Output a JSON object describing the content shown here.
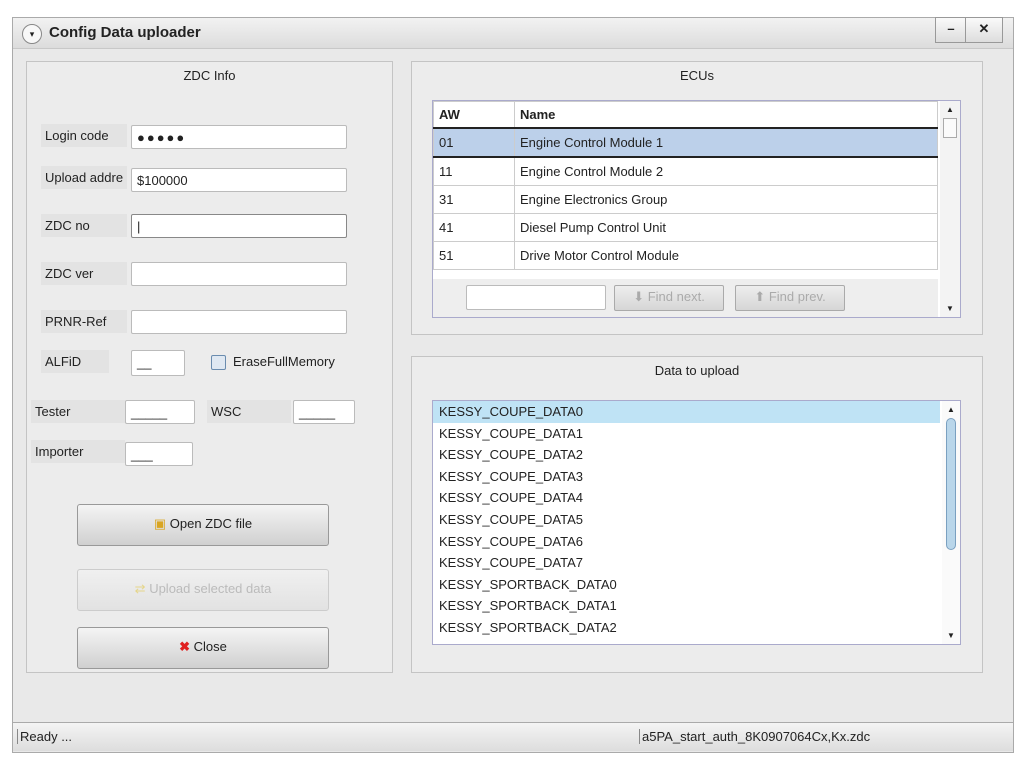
{
  "window": {
    "title": "Config Data uploader",
    "minimize": "–",
    "close": "✕",
    "menu_glyph": "▾"
  },
  "zdc": {
    "title": "ZDC Info",
    "login_label": "Login code",
    "login_value": "●●●●●",
    "upload_label": "Upload addre",
    "upload_value": "$100000",
    "zdcno_label": "ZDC no",
    "zdcver_label": "ZDC ver",
    "prnr_label": "PRNR-Ref",
    "alfid_label": "ALFiD",
    "alfid_value": "__",
    "erase_label": "EraseFullMemory",
    "tester_label": "Tester",
    "tester_value": "_____",
    "wsc_label": "WSC",
    "wsc_value": "_____",
    "importer_label": "Importer",
    "importer_value": "___",
    "open_label": "Open ZDC file",
    "upload_btn_label": "Upload selected data",
    "close_label": "Close"
  },
  "ecus": {
    "title": "ECUs",
    "headers": [
      "AW",
      "Name"
    ],
    "rows": [
      [
        "01",
        "Engine Control Module 1"
      ],
      [
        "11",
        "Engine Control Module 2"
      ],
      [
        "31",
        "Engine Electronics Group"
      ],
      [
        "41",
        "Diesel Pump Control Unit"
      ],
      [
        "51",
        "Drive Motor Control Module"
      ]
    ],
    "find_next": "Find next.",
    "find_prev": "Find prev."
  },
  "upload": {
    "title": "Data to upload",
    "items": [
      "KESSY_COUPE_DATA0",
      "KESSY_COUPE_DATA1",
      "KESSY_COUPE_DATA2",
      "KESSY_COUPE_DATA3",
      "KESSY_COUPE_DATA4",
      "KESSY_COUPE_DATA5",
      "KESSY_COUPE_DATA6",
      "KESSY_COUPE_DATA7",
      "KESSY_SPORTBACK_DATA0",
      "KESSY_SPORTBACK_DATA1",
      "KESSY_SPORTBACK_DATA2"
    ]
  },
  "status": {
    "left": "Ready ...",
    "right": "a5PA_start_auth_8K0907064Cx,Kx.zdc"
  }
}
